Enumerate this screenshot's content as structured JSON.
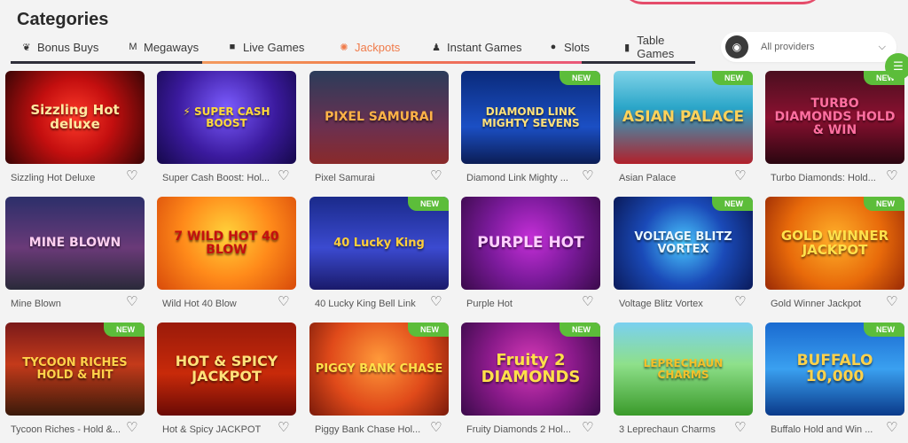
{
  "page": {
    "title": "Categories"
  },
  "tabs": [
    {
      "label": "Bonus Buys",
      "icon": "money-bag-icon",
      "glyph": "❦",
      "active": false
    },
    {
      "label": "Megaways",
      "icon": "megaways-icon",
      "glyph": "M",
      "active": false
    },
    {
      "label": "Live Games",
      "icon": "video-camera-icon",
      "glyph": "■",
      "active": false
    },
    {
      "label": "Jackpots",
      "icon": "jackpot-coin-icon",
      "glyph": "✺",
      "active": true
    },
    {
      "label": "Instant Games",
      "icon": "joystick-icon",
      "glyph": "♟",
      "active": false
    },
    {
      "label": "Slots",
      "icon": "slots-icon",
      "glyph": "●",
      "active": false
    },
    {
      "label": "Table Games",
      "icon": "cards-icon",
      "glyph": "▮",
      "active": false
    }
  ],
  "provider_select": {
    "placeholder": "All providers",
    "icon": "gamepad-icon",
    "chevron": "chevron-down-icon"
  },
  "menu_button": {
    "icon": "menu-icon"
  },
  "badge_label": "NEW",
  "games": [
    {
      "name": "Sizzling Hot Deluxe",
      "logo": "Sizzling Hot deluxe",
      "is_new": false,
      "bg": "radial-gradient(circle at 50% 50%, #ff3b2a 0%, #c40f0f 45%, #3a0505 100%)",
      "fg": "#ffe9a0"
    },
    {
      "name": "Super Cash Boost: Hol...",
      "logo": "⚡ SUPER CASH BOOST",
      "is_new": false,
      "bg": "radial-gradient(circle at 50% 40%, #7b5cff 0%, #3b1a9e 55%, #15084a 100%)",
      "fg": "#ffd93a"
    },
    {
      "name": "Pixel Samurai",
      "logo": "PIXEL SAMURAI",
      "is_new": false,
      "bg": "linear-gradient(180deg,#2b3c5a 0%,#6b3050 60%,#8a2a2a 100%)",
      "fg": "#ffb347"
    },
    {
      "name": "Diamond Link Mighty ...",
      "logo": "DIAMOND LINK MIGHTY SEVENS",
      "is_new": true,
      "bg": "linear-gradient(180deg,#0a2a7a 0%,#1b4fc4 60%,#0b1d55 100%)",
      "fg": "#ffe17a"
    },
    {
      "name": "Asian Palace",
      "logo": "ASIAN PALACE",
      "is_new": true,
      "bg": "linear-gradient(180deg,#7fd3e8 0%,#2aa5c8 40%,#b2202a 100%)",
      "fg": "#ffd25a"
    },
    {
      "name": "Turbo Diamonds: Hold...",
      "logo": "TURBO DIAMONDS HOLD & WIN",
      "is_new": true,
      "bg": "linear-gradient(180deg,#4a0f1f 0%,#8a1030 50%,#2a0610 100%)",
      "fg": "#ff6fa0"
    },
    {
      "name": "Mine Blown",
      "logo": "MINE BLOWN",
      "is_new": false,
      "bg": "linear-gradient(180deg,#2c2f6a 0%,#6a3a78 55%,#2a2a3a 100%)",
      "fg": "#ffd0f0"
    },
    {
      "name": "Wild Hot 40 Blow",
      "logo": "7 WILD HOT 40 BLOW",
      "is_new": false,
      "bg": "radial-gradient(circle at 50% 40%, #ffd23a 0%, #ff8a1a 50%, #d84a0a 100%)",
      "fg": "#c40f0f"
    },
    {
      "name": "40 Lucky King Bell Link",
      "logo": "40 Lucky King",
      "is_new": true,
      "bg": "linear-gradient(180deg,#1a2a8a 0%,#3b4ad0 55%,#1a1a6a 100%)",
      "fg": "#ffcf3a"
    },
    {
      "name": "Purple Hot",
      "logo": "PURPLE HOT",
      "is_new": false,
      "bg": "radial-gradient(circle at 50% 45%, #c52fd8 0%, #7a1a9a 50%, #3a0a4a 100%)",
      "fg": "#ffd0ff"
    },
    {
      "name": "Voltage Blitz Vortex",
      "logo": "VOLTAGE BLITZ VORTEX",
      "is_new": true,
      "bg": "radial-gradient(circle at 50% 50%, #4ac8ff 0%, #1a4ab8 50%, #0a1a5a 100%)",
      "fg": "#e8f6ff"
    },
    {
      "name": "Gold Winner Jackpot",
      "logo": "GOLD WINNER JACKPOT",
      "is_new": true,
      "bg": "radial-gradient(circle at 50% 45%, #ffb02a 0%, #e86a0a 55%, #9a2a05 100%)",
      "fg": "#ffe04a"
    },
    {
      "name": "Tycoon Riches - Hold &...",
      "logo": "TYCOON RICHES HOLD & HIT",
      "is_new": true,
      "bg": "linear-gradient(180deg,#7a1a1a 0%,#c43a1a 45%,#3a1a0a 100%)",
      "fg": "#ffd24a"
    },
    {
      "name": "Hot & Spicy JACKPOT",
      "logo": "HOT & SPICY JACKPOT",
      "is_new": false,
      "bg": "linear-gradient(180deg,#9a1a0a 0%,#c82a0a 55%,#6a0a05 100%)",
      "fg": "#ffe27a"
    },
    {
      "name": "Piggy Bank Chase Hol...",
      "logo": "PIGGY BANK CHASE",
      "is_new": true,
      "bg": "radial-gradient(circle at 50% 40%, #ff9a3a 0%, #e04a1a 55%, #7a1a0a 100%)",
      "fg": "#ffe14a"
    },
    {
      "name": "Fruity Diamonds 2 Hol...",
      "logo": "Fruity 2 DIAMONDS",
      "is_new": true,
      "bg": "radial-gradient(circle at 50% 45%, #d83ab8 0%, #8a1a8a 50%, #3a0a4a 100%)",
      "fg": "#ffe04a"
    },
    {
      "name": "3 Leprechaun Charms",
      "logo": "LEPRECHAUN CHARMS",
      "is_new": false,
      "bg": "linear-gradient(180deg,#7ad0f0 0%,#8ee08a 45%,#3a9a2a 100%)",
      "fg": "#f4c02a"
    },
    {
      "name": "Buffalo Hold and Win ...",
      "logo": "BUFFALO 10,000",
      "is_new": true,
      "bg": "linear-gradient(180deg,#1a6ad0 0%,#3aa0f0 50%,#0a3a8a 100%)",
      "fg": "#ffd24a"
    }
  ]
}
